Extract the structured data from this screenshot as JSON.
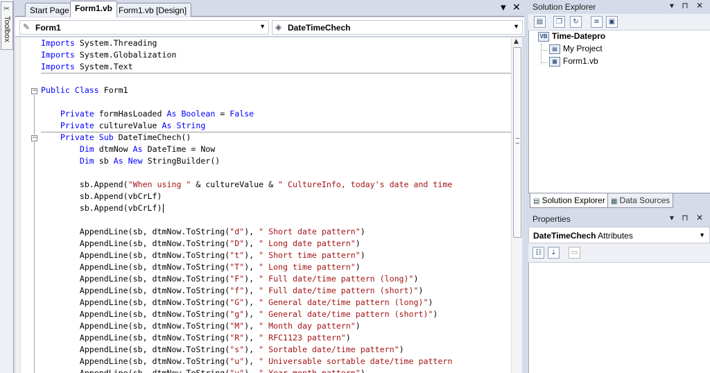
{
  "toolbox": {
    "label": "Toolbox"
  },
  "document_tabs": [
    {
      "label": "Start Page",
      "active": false
    },
    {
      "label": "Form1.vb",
      "active": true
    },
    {
      "label": "Form1.vb [Design]",
      "active": false
    }
  ],
  "tab_controls": {
    "dropdown": "▼",
    "close": "✕"
  },
  "nav": {
    "class_combo": "Form1",
    "member_combo": "DateTimeChech"
  },
  "code_lines": [
    [
      [
        "kw",
        "Imports"
      ],
      [
        "t",
        " System.Threading"
      ]
    ],
    [
      [
        "kw",
        "Imports"
      ],
      [
        "t",
        " System.Globalization"
      ]
    ],
    [
      [
        "kw",
        "Imports"
      ],
      [
        "t",
        " System.Text"
      ]
    ],
    [
      [
        "t",
        ""
      ]
    ],
    [
      [
        "kw",
        "Public Class"
      ],
      [
        "t",
        " Form1"
      ]
    ],
    [
      [
        "t",
        ""
      ]
    ],
    [
      [
        "t",
        "    "
      ],
      [
        "kw",
        "Private"
      ],
      [
        "t",
        " formHasLoaded "
      ],
      [
        "kw",
        "As Boolean"
      ],
      [
        "t",
        " = "
      ],
      [
        "kw",
        "False"
      ]
    ],
    [
      [
        "t",
        "    "
      ],
      [
        "kw",
        "Private"
      ],
      [
        "t",
        " cultureValue "
      ],
      [
        "kw",
        "As String"
      ]
    ],
    [
      [
        "t",
        "    "
      ],
      [
        "kw",
        "Private Sub"
      ],
      [
        "t",
        " DateTimeChech()"
      ]
    ],
    [
      [
        "t",
        "        "
      ],
      [
        "kw",
        "Dim"
      ],
      [
        "t",
        " dtmNow "
      ],
      [
        "kw",
        "As"
      ],
      [
        "t",
        " DateTime = Now"
      ]
    ],
    [
      [
        "t",
        "        "
      ],
      [
        "kw",
        "Dim"
      ],
      [
        "t",
        " sb "
      ],
      [
        "kw",
        "As New"
      ],
      [
        "t",
        " StringBuilder()"
      ]
    ],
    [
      [
        "t",
        ""
      ]
    ],
    [
      [
        "t",
        "        sb.Append("
      ],
      [
        "str",
        "\"When using \""
      ],
      [
        "t",
        " & cultureValue & "
      ],
      [
        "str",
        "\" CultureInfo, today's date and time"
      ]
    ],
    [
      [
        "t",
        "        sb.Append(vbCrLf)"
      ]
    ],
    [
      [
        "t",
        "        sb.Append(vbCrLf)"
      ]
    ],
    [
      [
        "t",
        ""
      ]
    ],
    [
      [
        "t",
        "        AppendLine(sb, dtmNow.ToString("
      ],
      [
        "str",
        "\"d\""
      ],
      [
        "t",
        "), "
      ],
      [
        "str",
        "\" Short date pattern\""
      ],
      [
        "t",
        ")"
      ]
    ],
    [
      [
        "t",
        "        AppendLine(sb, dtmNow.ToString("
      ],
      [
        "str",
        "\"D\""
      ],
      [
        "t",
        "), "
      ],
      [
        "str",
        "\" Long date pattern\""
      ],
      [
        "t",
        ")"
      ]
    ],
    [
      [
        "t",
        "        AppendLine(sb, dtmNow.ToString("
      ],
      [
        "str",
        "\"t\""
      ],
      [
        "t",
        "), "
      ],
      [
        "str",
        "\" Short time pattern\""
      ],
      [
        "t",
        ")"
      ]
    ],
    [
      [
        "t",
        "        AppendLine(sb, dtmNow.ToString("
      ],
      [
        "str",
        "\"T\""
      ],
      [
        "t",
        "), "
      ],
      [
        "str",
        "\" Long time pattern\""
      ],
      [
        "t",
        ")"
      ]
    ],
    [
      [
        "t",
        "        AppendLine(sb, dtmNow.ToString("
      ],
      [
        "str",
        "\"F\""
      ],
      [
        "t",
        "), "
      ],
      [
        "str",
        "\" Full date/time pattern (long)\""
      ],
      [
        "t",
        ")"
      ]
    ],
    [
      [
        "t",
        "        AppendLine(sb, dtmNow.ToString("
      ],
      [
        "str",
        "\"f\""
      ],
      [
        "t",
        "), "
      ],
      [
        "str",
        "\" Full date/time pattern (short)\""
      ],
      [
        "t",
        ")"
      ]
    ],
    [
      [
        "t",
        "        AppendLine(sb, dtmNow.ToString("
      ],
      [
        "str",
        "\"G\""
      ],
      [
        "t",
        "), "
      ],
      [
        "str",
        "\" General date/time pattern (long)\""
      ],
      [
        "t",
        ")"
      ]
    ],
    [
      [
        "t",
        "        AppendLine(sb, dtmNow.ToString("
      ],
      [
        "str",
        "\"g\""
      ],
      [
        "t",
        "), "
      ],
      [
        "str",
        "\" General date/time pattern (short)\""
      ],
      [
        "t",
        ")"
      ]
    ],
    [
      [
        "t",
        "        AppendLine(sb, dtmNow.ToString("
      ],
      [
        "str",
        "\"M\""
      ],
      [
        "t",
        "), "
      ],
      [
        "str",
        "\" Month day pattern\""
      ],
      [
        "t",
        ")"
      ]
    ],
    [
      [
        "t",
        "        AppendLine(sb, dtmNow.ToString("
      ],
      [
        "str",
        "\"R\""
      ],
      [
        "t",
        "), "
      ],
      [
        "str",
        "\" RFC1123 pattern\""
      ],
      [
        "t",
        ")"
      ]
    ],
    [
      [
        "t",
        "        AppendLine(sb, dtmNow.ToString("
      ],
      [
        "str",
        "\"s\""
      ],
      [
        "t",
        "), "
      ],
      [
        "str",
        "\" Sortable date/time pattern\""
      ],
      [
        "t",
        ")"
      ]
    ],
    [
      [
        "t",
        "        AppendLine(sb, dtmNow.ToString("
      ],
      [
        "str",
        "\"u\""
      ],
      [
        "t",
        "), "
      ],
      [
        "str",
        "\" Universable sortable date/time pattern"
      ]
    ],
    [
      [
        "t",
        "        AppendLine(sb, dtmNow.ToString("
      ],
      [
        "str",
        "\"y\""
      ],
      [
        "t",
        "), "
      ],
      [
        "str",
        "\" Year month pattern\""
      ],
      [
        "t",
        ")"
      ]
    ]
  ],
  "solution_explorer": {
    "title": "Solution Explorer",
    "title_buttons": "▾ ⊓ ✕",
    "tree": [
      {
        "label": "Time-Datepro",
        "bold": true,
        "icon": "VB"
      },
      {
        "label": "My Project",
        "bold": false,
        "icon": "▤"
      },
      {
        "label": "Form1.vb",
        "bold": false,
        "icon": "▦"
      }
    ]
  },
  "bottom_tabs": [
    {
      "label": "Solution Explorer",
      "active": true
    },
    {
      "label": "Data Sources",
      "active": false
    }
  ],
  "properties": {
    "title": "Properties",
    "title_buttons": "▾ ⊓ ✕",
    "object_name": "DateTimeChech",
    "object_type": "Attributes"
  },
  "colors": {
    "keyword": "#0000ff",
    "string": "#a31515",
    "chrome": "#d6dbe9"
  }
}
